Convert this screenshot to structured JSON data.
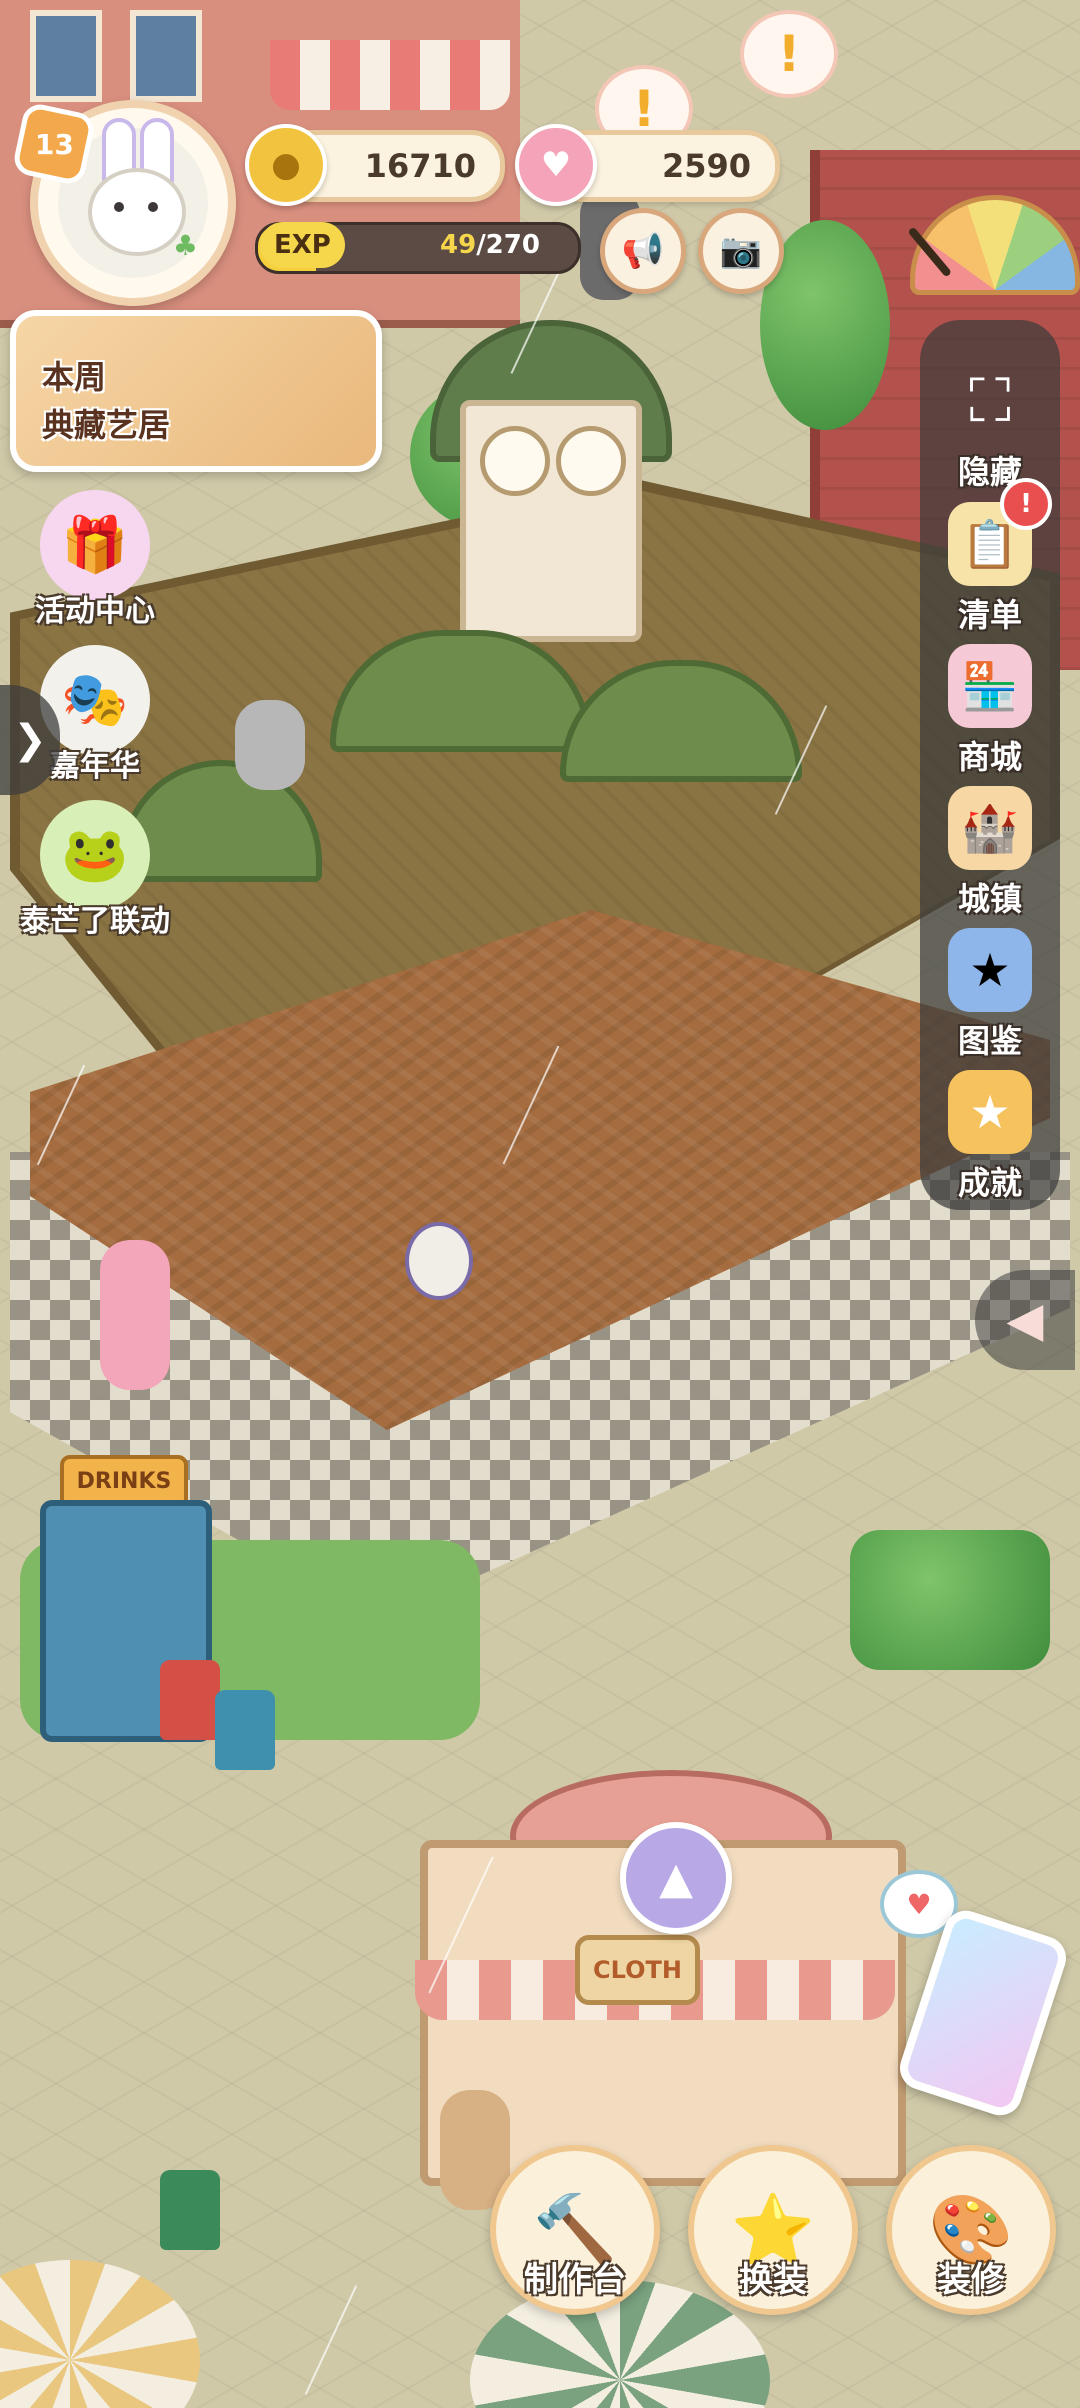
{
  "player": {
    "level": "13",
    "avatar_icon": "bunny-icon"
  },
  "resources": {
    "coins": "16710",
    "coin_icon": "bunny-coin-icon",
    "hearts": "2590",
    "heart_icon": "heart-gem-icon"
  },
  "exp": {
    "label": "EXP",
    "current": "49",
    "separator_max": "/270",
    "progress": 0.1815
  },
  "top_buttons": {
    "announcement_icon": "megaphone-icon",
    "camera_icon": "camera-icon"
  },
  "weekly_banner": {
    "line1": "本周",
    "line2": "典藏艺居"
  },
  "left_menu": [
    {
      "label": "活动中心",
      "icon": "gift-box-icon"
    },
    {
      "label": "嘉年华",
      "icon": "jester-icon"
    },
    {
      "label": "泰芒了联动",
      "icon": "frog-crown-icon"
    }
  ],
  "right_menu": [
    {
      "label": "隐藏",
      "icon": "fullscreen-brackets-icon"
    },
    {
      "label": "清单",
      "icon": "checklist-icon",
      "alert": "!"
    },
    {
      "label": "商城",
      "icon": "shop-icon"
    },
    {
      "label": "城镇",
      "icon": "castle-icon"
    },
    {
      "label": "图鉴",
      "icon": "book-star-icon"
    },
    {
      "label": "成就",
      "icon": "star-badge-icon"
    }
  ],
  "bottom_menu": [
    {
      "label": "制作台",
      "icon": "workbench-icon"
    },
    {
      "label": "换装",
      "icon": "outfit-star-icon"
    },
    {
      "label": "装修",
      "icon": "paint-roller-icon"
    }
  ],
  "scene": {
    "drinks_sign": "DRINKS",
    "shop_sign": "CLOTH"
  },
  "colors": {
    "accent": "#f3a94b",
    "exp_fill": "#f3d03c",
    "panel": "#3c3c3c",
    "alert": "#e94f4f"
  }
}
